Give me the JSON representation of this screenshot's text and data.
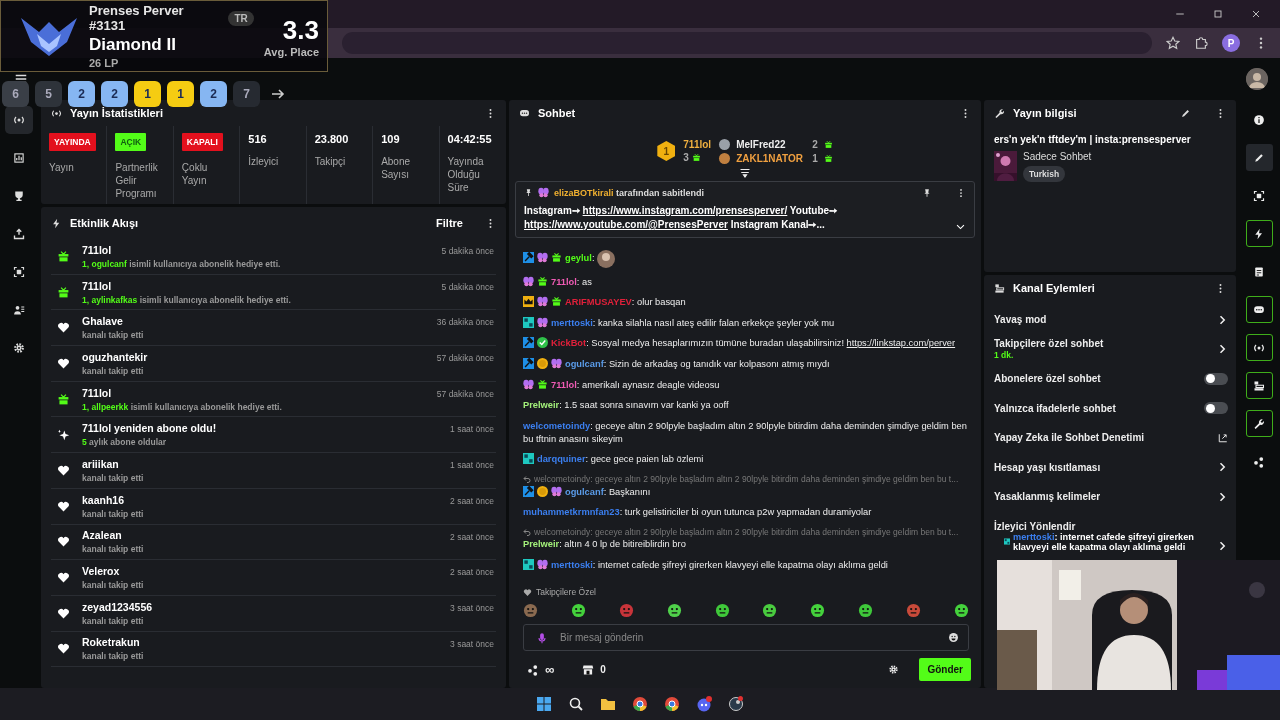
{
  "tft_overlay": {
    "player": "Prenses Perver #3131",
    "region": "TR",
    "rank": "Diamond II",
    "lp": "26 LP",
    "avg_place": "3.3",
    "avg_label": "Avg. Place",
    "placements": [
      {
        "value": "6",
        "color": "#3a3f47"
      },
      {
        "value": "5",
        "color": "#2e333a"
      },
      {
        "value": "2",
        "color": "#86b6f2"
      },
      {
        "value": "2",
        "color": "#86b6f2"
      },
      {
        "value": "1",
        "color": "#f5cc12"
      },
      {
        "value": "1",
        "color": "#f5cc12"
      },
      {
        "value": "2",
        "color": "#86b6f2"
      },
      {
        "value": "7",
        "color": "#262a31"
      }
    ]
  },
  "browser": {
    "profile_initial": "P"
  },
  "left_rail": [
    {
      "kind": "stream",
      "selected": true
    },
    {
      "kind": "chart",
      "selected": false
    },
    {
      "kind": "trophy",
      "selected": false
    },
    {
      "kind": "upload",
      "selected": false
    },
    {
      "kind": "capture",
      "selected": false
    },
    {
      "kind": "users",
      "selected": false
    },
    {
      "kind": "settings",
      "selected": false
    }
  ],
  "stats": {
    "title": "Yayın İstatistikleri",
    "items": [
      {
        "kind": "status",
        "badge": "YAYINDA",
        "color": "#e3101d",
        "label": "Yayın"
      },
      {
        "kind": "status",
        "badge": "AÇIK",
        "color": "#53fc18",
        "label": "Partnerlik Gelir Programı"
      },
      {
        "kind": "status",
        "badge": "KAPALI",
        "color": "#e3101d",
        "label": "Çoklu Yayın"
      },
      {
        "kind": "number",
        "value": "516",
        "label": "İzleyici"
      },
      {
        "kind": "number",
        "value": "23.800",
        "label": "Takipçi"
      },
      {
        "kind": "number",
        "value": "109",
        "label": "Abone Sayısı"
      },
      {
        "kind": "number",
        "value": "04:42:55",
        "label": "Yayında Olduğu Süre"
      }
    ]
  },
  "activity": {
    "title": "Etkinlik Akışı",
    "filter": "Filtre",
    "items": [
      {
        "kind": "gift",
        "user": "711lol",
        "highlight": "1, ogulcanf",
        "detail": "isimli kullanıcıya abonelik hediye etti.",
        "time": "5 dakika önce"
      },
      {
        "kind": "gift",
        "user": "711lol",
        "highlight": "1, aylinkafkas",
        "detail": "isimli kullanıcıya abonelik hediye etti.",
        "time": "5 dakika önce"
      },
      {
        "kind": "follow",
        "user": "Ghalave",
        "detail": "kanalı takip etti",
        "time": "36 dakika önce"
      },
      {
        "kind": "follow",
        "user": "oguzhantekir",
        "detail": "kanalı takip etti",
        "time": "57 dakika önce"
      },
      {
        "kind": "gift",
        "user": "711lol",
        "highlight": "1, allpeerkk",
        "detail": "isimli kullanıcıya abonelik hediye etti.",
        "time": "57 dakika önce"
      },
      {
        "kind": "resub",
        "user": "711lol yeniden abone oldu!",
        "highlight": "5",
        "detail": "aylık abone oldular",
        "time": "1 saat önce"
      },
      {
        "kind": "follow",
        "user": "ariiikan",
        "detail": "kanalı takip etti",
        "time": "1 saat önce"
      },
      {
        "kind": "follow",
        "user": "kaanh16",
        "detail": "kanalı takip etti",
        "time": "2 saat önce"
      },
      {
        "kind": "follow",
        "user": "Azalean",
        "detail": "kanalı takip etti",
        "time": "2 saat önce"
      },
      {
        "kind": "follow",
        "user": "Velerox",
        "detail": "kanalı takip etti",
        "time": "2 saat önce"
      },
      {
        "kind": "follow",
        "user": "zeyad1234556",
        "detail": "kanalı takip etti",
        "time": "3 saat önce"
      },
      {
        "kind": "follow",
        "user": "Roketrakun",
        "detail": "kanalı takip etti",
        "time": "3 saat önce"
      }
    ]
  },
  "chat": {
    "title": "Sohbet",
    "leaders": [
      {
        "rank": "1",
        "name": "711lol",
        "count": "3"
      },
      {
        "name": "MelFred22",
        "count": "2"
      },
      {
        "name": "ZAKL1NATOR",
        "count": "1"
      }
    ],
    "pinned": {
      "by": "elizaBOTkirali",
      "by_text": "tarafından sabitlendi",
      "body": [
        {
          "kind": "text",
          "text": "Instagram➙ "
        },
        {
          "kind": "link",
          "text": "https://www.instagram.com/prensesperver/"
        },
        {
          "kind": "text",
          "text": " Youtube➙ "
        },
        {
          "kind": "link",
          "text": "https://www.youtube.com/@PrensesPerver"
        },
        {
          "kind": "text",
          "text": " Instagram Kanal➙..."
        }
      ]
    },
    "messages": [
      {
        "badges": [
          {
            "kind": "mod"
          },
          {
            "kind": "sub"
          },
          {
            "kind": "gift"
          }
        ],
        "user": "geylul",
        "color": "#53fc18",
        "text": ":",
        "emote": true
      },
      {
        "badges": [
          {
            "kind": "sub"
          },
          {
            "kind": "gift"
          }
        ],
        "user": "711lol",
        "color": "#f05bb5",
        "text": ": as"
      },
      {
        "badges": [
          {
            "kind": "crown"
          },
          {
            "kind": "sub"
          },
          {
            "kind": "gift"
          }
        ],
        "user": "ARIFMUSAYEV",
        "color": "#e0203a",
        "text": ": olur basqan"
      },
      {
        "badges": [
          {
            "kind": "og"
          },
          {
            "kind": "sub"
          }
        ],
        "user": "merttoski",
        "color": "#3b7ff0",
        "text": ": kanka silahla nasıl ateş edilir falan erkekçe şeyler yok mu"
      },
      {
        "badges": [
          {
            "kind": "mod"
          },
          {
            "kind": "verified"
          }
        ],
        "user": "KickBot",
        "color": "#e0203a",
        "text": ": Sosyal medya hesaplarımızın tümüne buradan ulaşabilirsiniz! ",
        "link": "https://linkstap.com/perver"
      },
      {
        "badges": [
          {
            "kind": "mod"
          },
          {
            "kind": "coin"
          },
          {
            "kind": "sub"
          }
        ],
        "user": "ogulcanf",
        "color": "#5a9be8",
        "text": ": Sizin de arkadaş og tanıdık var kolpasonı atmış mıydı"
      },
      {
        "badges": [
          {
            "kind": "sub"
          },
          {
            "kind": "gift"
          }
        ],
        "user": "711lol",
        "color": "#f05bb5",
        "text": ": amerikalı aynasız deagle videosu"
      },
      {
        "user": "Prelweir",
        "color": "#a3f07a",
        "text": ": 1.5 saat sonra sınavım var kanki ya ooff"
      },
      {
        "user": "welcometoindy",
        "color": "#3b7ff0",
        "text": ": geceye altın 2 90lpyle başladım altın 2 90lpyle bitirdim daha deminden şimdiye geldim ben bu tftnin anasını sikeyim"
      },
      {
        "badges": [
          {
            "kind": "og"
          }
        ],
        "user": "darqquiner",
        "color": "#3b7ff0",
        "text": ": gece gece paien lab özlemi"
      },
      {
        "badges": [
          {
            "kind": "mod"
          },
          {
            "kind": "coin"
          },
          {
            "kind": "sub"
          }
        ],
        "user": "ogulcanf",
        "color": "#5a9be8",
        "text": ": Başkanını",
        "reply": "welcometoindy: geceye altın 2 90lpyle başladım altın 2 90lpyle bitirdim daha deminden şimdiye geldim ben bu t..."
      },
      {
        "user": "muhammetkrmnfan23",
        "color": "#3b7ff0",
        "text": ": turk gelistiriciler bi oyun tutunca p2w yapmadan duramiyolar"
      },
      {
        "user": "Prelweir",
        "color": "#a3f07a",
        "text": ": altın 4 0 lp de bitireiblirdin bro",
        "reply": "welcometoindy: geceye altın 2 90lpyle başladım altın 2 90lpyle bitirdim daha deminden şimdiye geldim ben bu t..."
      },
      {
        "badges": [
          {
            "kind": "og"
          },
          {
            "kind": "sub"
          }
        ],
        "user": "merttoski",
        "color": "#3b7ff0",
        "text": ": internet cafede şifreyi girerken klavyeyi elle kapatma olayı aklıma geldi"
      }
    ],
    "emote_section": "Takipçilere Özel",
    "input": {
      "placeholder": "Bir mesaj gönderin"
    },
    "points": "∞",
    "store_count": "0",
    "send": "Gönder"
  },
  "stream_info": {
    "title": "Yayın bilgisi",
    "stream_title": "ers'n yek'n tftdey'm | insta:prensesperver",
    "category": "Sadece Sohbet",
    "tag": "Turkish"
  },
  "channel_actions": {
    "title": "Kanal Eylemleri",
    "items": [
      {
        "kind": "link",
        "label": "Yavaş mod"
      },
      {
        "kind": "link",
        "label": "Takipçilere özel sohbet",
        "sub": "1 dk."
      },
      {
        "kind": "toggle",
        "label": "Abonelere özel sohbet",
        "on": false
      },
      {
        "kind": "toggle",
        "label": "Yalnızca ifadelerle sohbet",
        "on": false
      },
      {
        "kind": "external",
        "label": "Yapay Zeka ile Sohbet Denetimi"
      },
      {
        "kind": "link",
        "label": "Hesap yaşı kısıtlaması"
      },
      {
        "kind": "link",
        "label": "Yasaklanmış kelimeler"
      },
      {
        "kind": "plain",
        "label": "İzleyici Yönlendir"
      }
    ],
    "overlay_message": {
      "user": "merttoski",
      "text": ": internet cafede şifreyi girerken klavyeyi elle kapatma olayı aklıma geldi"
    }
  },
  "right_rail": [
    {
      "kind": "info",
      "outlined": false
    },
    {
      "kind": "pencil",
      "outlined": false
    },
    {
      "kind": "capture",
      "outlined": false
    },
    {
      "kind": "bolt",
      "outlined": true
    },
    {
      "kind": "doc",
      "outlined": false
    },
    {
      "kind": "chat",
      "outlined": true
    },
    {
      "kind": "stream",
      "outlined": true
    },
    {
      "kind": "layout",
      "outlined": true
    },
    {
      "kind": "wrench",
      "outlined": true
    },
    {
      "kind": "share",
      "outlined": false
    }
  ],
  "taskbar": [
    {
      "kind": "windows"
    },
    {
      "kind": "search"
    },
    {
      "kind": "folder"
    },
    {
      "kind": "chrome"
    },
    {
      "kind": "chrome"
    },
    {
      "kind": "discord"
    },
    {
      "kind": "steam"
    }
  ]
}
